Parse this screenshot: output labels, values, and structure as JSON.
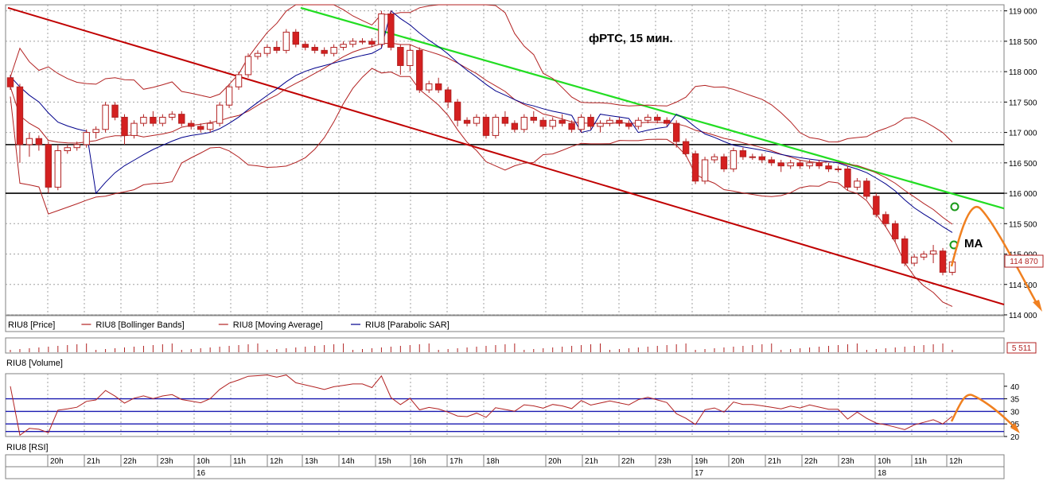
{
  "annotation_title": "фРТС, 15 мин.",
  "annotation_ma": "МА",
  "price_panel": {
    "y_ticks": [
      114000,
      114500,
      115000,
      115500,
      116000,
      116500,
      117000,
      117500,
      118000,
      118500,
      119000
    ],
    "tick_labels": [
      "114 000",
      "114 500",
      "115 000",
      "115 500",
      "116 000",
      "116 500",
      "117 000",
      "117 500",
      "118 000",
      "118 500",
      "119 000"
    ],
    "ylim": [
      114000,
      119100
    ],
    "last_price_label": "114 870",
    "hlines": [
      116800,
      116000
    ]
  },
  "legend": [
    {
      "label": "RIU8 [Price]",
      "color": "#b22222"
    },
    {
      "label": "RIU8 [Bollinger Bands]",
      "color": "#b22222"
    },
    {
      "label": "RIU8 [Moving Average]",
      "color": "#b22222"
    },
    {
      "label": "RIU8 [Parabolic SAR]",
      "color": "#00008b"
    }
  ],
  "volume_panel": {
    "label": "RIU8 [Volume]",
    "last_value_label": "5 511"
  },
  "rsi_panel": {
    "label": "RIU8 [RSI]",
    "y_ticks": [
      20,
      25,
      30,
      35,
      40
    ],
    "ylim": [
      20,
      45
    ],
    "hlines": [
      35,
      30,
      25,
      22
    ]
  },
  "time_axis": {
    "hour_labels": [
      "20h",
      "21h",
      "22h",
      "23h",
      "10h",
      "11h",
      "12h",
      "13h",
      "14h",
      "15h",
      "16h",
      "17h",
      "18h",
      "20h",
      "21h",
      "22h",
      "23h",
      "19h",
      "20h",
      "21h",
      "22h",
      "23h",
      "10h",
      "11h",
      "12h"
    ],
    "day_labels": [
      "16",
      "17",
      "18"
    ]
  },
  "colors": {
    "candle_down": "#d42020",
    "candle_up": "#ffffff",
    "bands": "#b22222",
    "sar": "#00008b",
    "trend_green": "#22dd22",
    "trend_red": "#c00000",
    "forecast": "#f08020",
    "grid": "#a0a0a0"
  },
  "chart_data": {
    "type": "candlestick",
    "title": "фРТС, 15 мин.",
    "ohlc": [
      [
        117900,
        117950,
        117700,
        117750
      ],
      [
        117750,
        117800,
        116500,
        116800
      ],
      [
        116800,
        117000,
        116600,
        116900
      ],
      [
        116900,
        116950,
        116700,
        116800
      ],
      [
        116800,
        116850,
        116000,
        116100
      ],
      [
        116100,
        116800,
        116050,
        116700
      ],
      [
        116700,
        116800,
        116650,
        116750
      ],
      [
        116750,
        116850,
        116700,
        116800
      ],
      [
        116800,
        117050,
        116750,
        117000
      ],
      [
        117000,
        117100,
        116900,
        117050
      ],
      [
        117050,
        117500,
        117000,
        117450
      ],
      [
        117450,
        117500,
        117200,
        117250
      ],
      [
        117250,
        117300,
        116800,
        116950
      ],
      [
        116950,
        117200,
        116900,
        117150
      ],
      [
        117150,
        117300,
        117100,
        117250
      ],
      [
        117250,
        117350,
        117100,
        117150
      ],
      [
        117150,
        117300,
        117100,
        117250
      ],
      [
        117250,
        117350,
        117200,
        117300
      ],
      [
        117300,
        117350,
        117100,
        117150
      ],
      [
        117150,
        117200,
        117050,
        117100
      ],
      [
        117100,
        117150,
        117000,
        117050
      ],
      [
        117050,
        117200,
        117000,
        117150
      ],
      [
        117150,
        117500,
        117100,
        117450
      ],
      [
        117450,
        117800,
        117400,
        117750
      ],
      [
        117750,
        118000,
        117700,
        117950
      ],
      [
        117950,
        118300,
        117900,
        118250
      ],
      [
        118250,
        118350,
        118200,
        118300
      ],
      [
        118300,
        118450,
        118250,
        118400
      ],
      [
        118400,
        118500,
        118300,
        118350
      ],
      [
        118350,
        118700,
        118300,
        118650
      ],
      [
        118650,
        118700,
        118400,
        118450
      ],
      [
        118450,
        118500,
        118350,
        118400
      ],
      [
        118400,
        118450,
        118300,
        118350
      ],
      [
        118350,
        118400,
        118250,
        118300
      ],
      [
        118300,
        118450,
        118250,
        118400
      ],
      [
        118400,
        118500,
        118350,
        118450
      ],
      [
        118450,
        118550,
        118400,
        118500
      ],
      [
        118500,
        118550,
        118450,
        118500
      ],
      [
        118500,
        118550,
        118400,
        118450
      ],
      [
        118450,
        119000,
        118400,
        118950
      ],
      [
        118950,
        119000,
        118350,
        118400
      ],
      [
        118400,
        118450,
        117950,
        118100
      ],
      [
        118100,
        118450,
        118000,
        118350
      ],
      [
        118350,
        118400,
        117650,
        117700
      ],
      [
        117700,
        117850,
        117650,
        117800
      ],
      [
        117800,
        117900,
        117650,
        117700
      ],
      [
        117700,
        117750,
        117400,
        117500
      ],
      [
        117500,
        117550,
        117100,
        117200
      ],
      [
        117200,
        117250,
        117100,
        117150
      ],
      [
        117150,
        117300,
        117100,
        117250
      ],
      [
        117250,
        117300,
        116900,
        116950
      ],
      [
        116950,
        117300,
        116900,
        117250
      ],
      [
        117250,
        117350,
        117100,
        117150
      ],
      [
        117150,
        117200,
        117000,
        117050
      ],
      [
        117050,
        117300,
        117000,
        117250
      ],
      [
        117250,
        117350,
        117150,
        117200
      ],
      [
        117200,
        117250,
        117050,
        117100
      ],
      [
        117100,
        117250,
        117050,
        117200
      ],
      [
        117200,
        117300,
        117100,
        117150
      ],
      [
        117150,
        117200,
        117000,
        117050
      ],
      [
        117050,
        117300,
        117000,
        117250
      ],
      [
        117250,
        117300,
        117050,
        117100
      ],
      [
        117100,
        117200,
        117000,
        117150
      ],
      [
        117150,
        117250,
        117100,
        117200
      ],
      [
        117200,
        117250,
        117100,
        117150
      ],
      [
        117150,
        117200,
        117050,
        117100
      ],
      [
        117100,
        117250,
        117050,
        117200
      ],
      [
        117200,
        117300,
        117150,
        117250
      ],
      [
        117250,
        117300,
        117150,
        117200
      ],
      [
        117200,
        117250,
        117100,
        117150
      ],
      [
        117150,
        117200,
        116750,
        116850
      ],
      [
        116850,
        116900,
        116600,
        116650
      ],
      [
        116650,
        116700,
        116150,
        116200
      ],
      [
        116200,
        116600,
        116150,
        116550
      ],
      [
        116550,
        116650,
        116500,
        116600
      ],
      [
        116600,
        116650,
        116350,
        116400
      ],
      [
        116400,
        116750,
        116350,
        116700
      ],
      [
        116700,
        116750,
        116550,
        116600
      ],
      [
        116600,
        116650,
        116550,
        116600
      ],
      [
        116600,
        116650,
        116500,
        116550
      ],
      [
        116550,
        116600,
        116450,
        116500
      ],
      [
        116500,
        116550,
        116350,
        116450
      ],
      [
        116450,
        116550,
        116400,
        116500
      ],
      [
        116500,
        116550,
        116400,
        116450
      ],
      [
        116450,
        116550,
        116400,
        116500
      ],
      [
        116500,
        116550,
        116400,
        116450
      ],
      [
        116450,
        116500,
        116350,
        116400
      ],
      [
        116400,
        116450,
        116350,
        116400
      ],
      [
        116400,
        116450,
        116050,
        116100
      ],
      [
        116100,
        116250,
        116050,
        116200
      ],
      [
        116200,
        116250,
        115900,
        115950
      ],
      [
        115950,
        116000,
        115600,
        115650
      ],
      [
        115650,
        115700,
        115450,
        115500
      ],
      [
        115500,
        115550,
        115200,
        115250
      ],
      [
        115250,
        115300,
        114800,
        114850
      ],
      [
        114850,
        115000,
        114800,
        114950
      ],
      [
        114950,
        115050,
        114900,
        115000
      ],
      [
        115000,
        115150,
        114850,
        115050
      ],
      [
        115050,
        115100,
        114650,
        114700
      ],
      [
        114700,
        114900,
        114650,
        114870
      ]
    ],
    "ylim": [
      114000,
      119100
    ],
    "x_labels": [
      "20h",
      "21h",
      "22h",
      "23h",
      "10h",
      "11h",
      "12h",
      "13h",
      "14h",
      "15h",
      "16h",
      "17h",
      "18h",
      "20h",
      "21h",
      "22h",
      "23h",
      "19h",
      "20h",
      "21h",
      "22h",
      "23h",
      "10h",
      "11h",
      "12h"
    ],
    "rsi_ylim": [
      20,
      45
    ]
  }
}
